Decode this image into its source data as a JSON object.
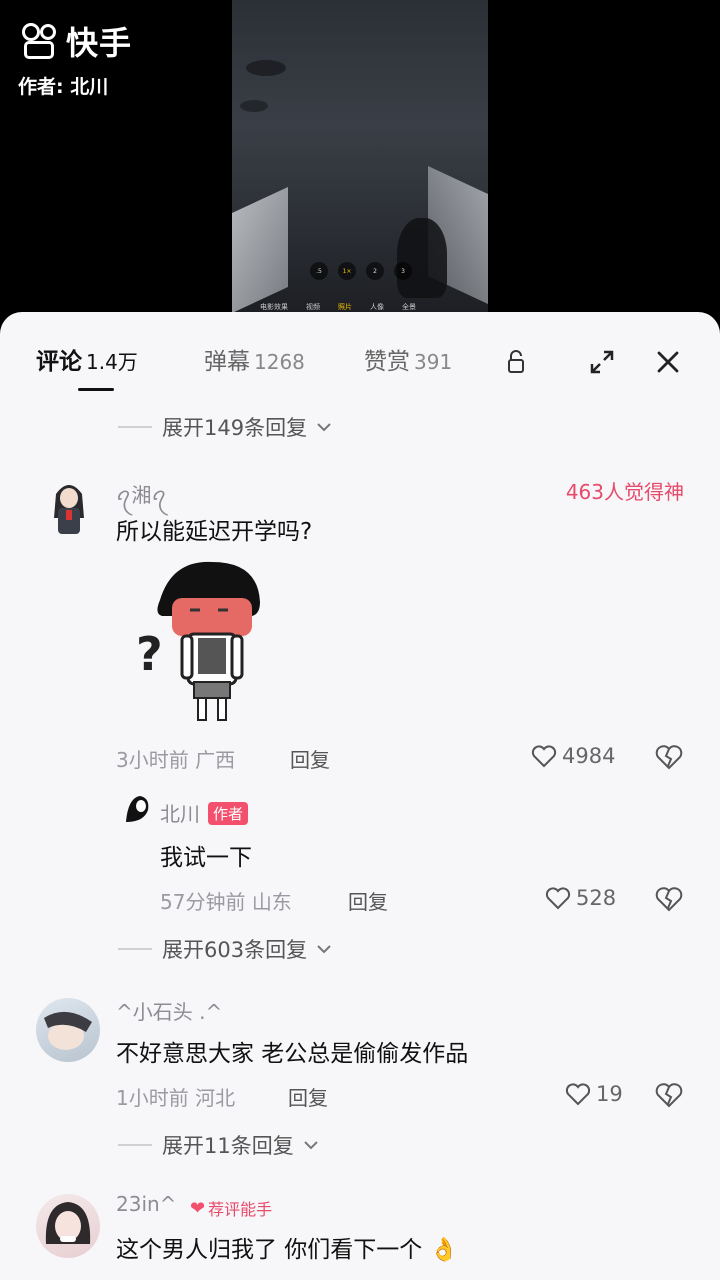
{
  "brand": {
    "name": "快手",
    "author": "作者: 北川"
  },
  "video": {
    "zoom_options": [
      ".5",
      "1×",
      "2",
      "3"
    ],
    "modes": [
      "电影效果",
      "视频",
      "照片",
      "人像",
      "全景"
    ]
  },
  "tabs": [
    {
      "label": "评论",
      "count": "1.4万"
    },
    {
      "label": "弹幕",
      "count": "1268"
    },
    {
      "label": "赞赏",
      "count": "391"
    }
  ],
  "colors": {
    "accent": "#f2506c",
    "hot_text": "#e84a6b"
  },
  "comments": {
    "expand_top": "展开149条回复",
    "c1": {
      "user": "ꪖ湘ꪖ",
      "hot": "463人觉得神",
      "text": "所以能延迟开学吗?",
      "time": "3小时前",
      "location": "广西",
      "reply": "回复",
      "likes": "4984"
    },
    "r1": {
      "user": "北川",
      "badge": "作者",
      "text": "我试一下",
      "time": "57分钟前",
      "location": "山东",
      "reply": "回复",
      "likes": "528"
    },
    "expand_1": "展开603条回复",
    "c2": {
      "user": "^小石头 .^",
      "text": "不好意思大家 老公总是偷偷发作品",
      "time": "1小时前",
      "location": "河北",
      "reply": "回复",
      "likes": "19"
    },
    "expand_2": "展开11条回复",
    "c3": {
      "user": "23in^",
      "badge": "荐评能手",
      "text": "这个男人归我了 你们看下一个 👌"
    }
  }
}
